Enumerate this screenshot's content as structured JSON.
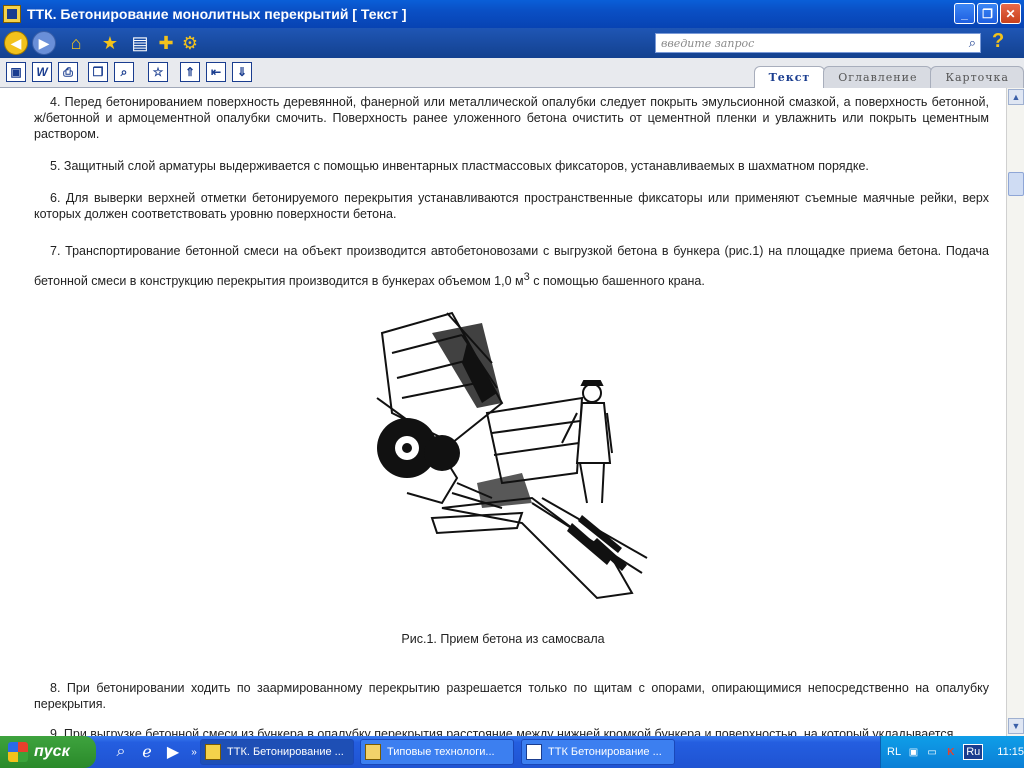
{
  "window": {
    "title": "ТТК. Бетонирование монолитных перекрытий [ Текст ]"
  },
  "search": {
    "placeholder": "введите запрос"
  },
  "tabs": [
    {
      "label": "Текст",
      "active": true
    },
    {
      "label": "Оглавление"
    },
    {
      "label": "Карточка"
    }
  ],
  "content": {
    "p4": "4. Перед бетонированием поверхность деревянной, фанерной или металлической опалубки следует покрыть эмульсионной смазкой, а поверхность бетонной, ж/бетонной и армоцементной опалубки смочить. Поверхность ранее уложенного бетона очистить от цементной пленки и увлажнить или покрыть цементным раствором.",
    "p5": "5. Защитный слой арматуры выдерживается с помощью инвентарных пластмассовых фиксаторов, устанавливаемых в шахматном порядке.",
    "p6": "6. Для выверки верхней отметки бетонируемого перекрытия устанавливаются пространственные фиксаторы или применяют съемные маячные рейки, верх которых должен соответствовать уровню поверхности бетона.",
    "p7a": "7. Транспортирование бетонной смеси на объект производится автобетоновозами с выгрузкой бетона в бункера (рис.1) на площадке приема бетона. Подача бетонной смеси в конструкцию перекрытия производится в бункерах объемом 1,0 м",
    "p7sup": "3",
    "p7b": " с помощью башенного крана.",
    "caption": "Рис.1. Прием бетона из самосвала",
    "p8": "8. При бетонировании ходить по заармированному перекрытию разрешается только по щитам с опорами, опирающимися непосредственно на опалубку перекрытия.",
    "p9": "9. При выгрузке бетонной смеси из бункера в опалубку перекрытия расстояние между нижней кромкой бункера и поверхностью, на который укладывается"
  },
  "taskbar": {
    "start_label": "пуск",
    "tasks": [
      {
        "label": "ТТК. Бетонирование ..."
      },
      {
        "label": "Типовые технологи..."
      },
      {
        "label": "ТТК Бетонирование ..."
      }
    ],
    "lang1": "RL",
    "lang2": "Ru",
    "clock": "11:15"
  }
}
